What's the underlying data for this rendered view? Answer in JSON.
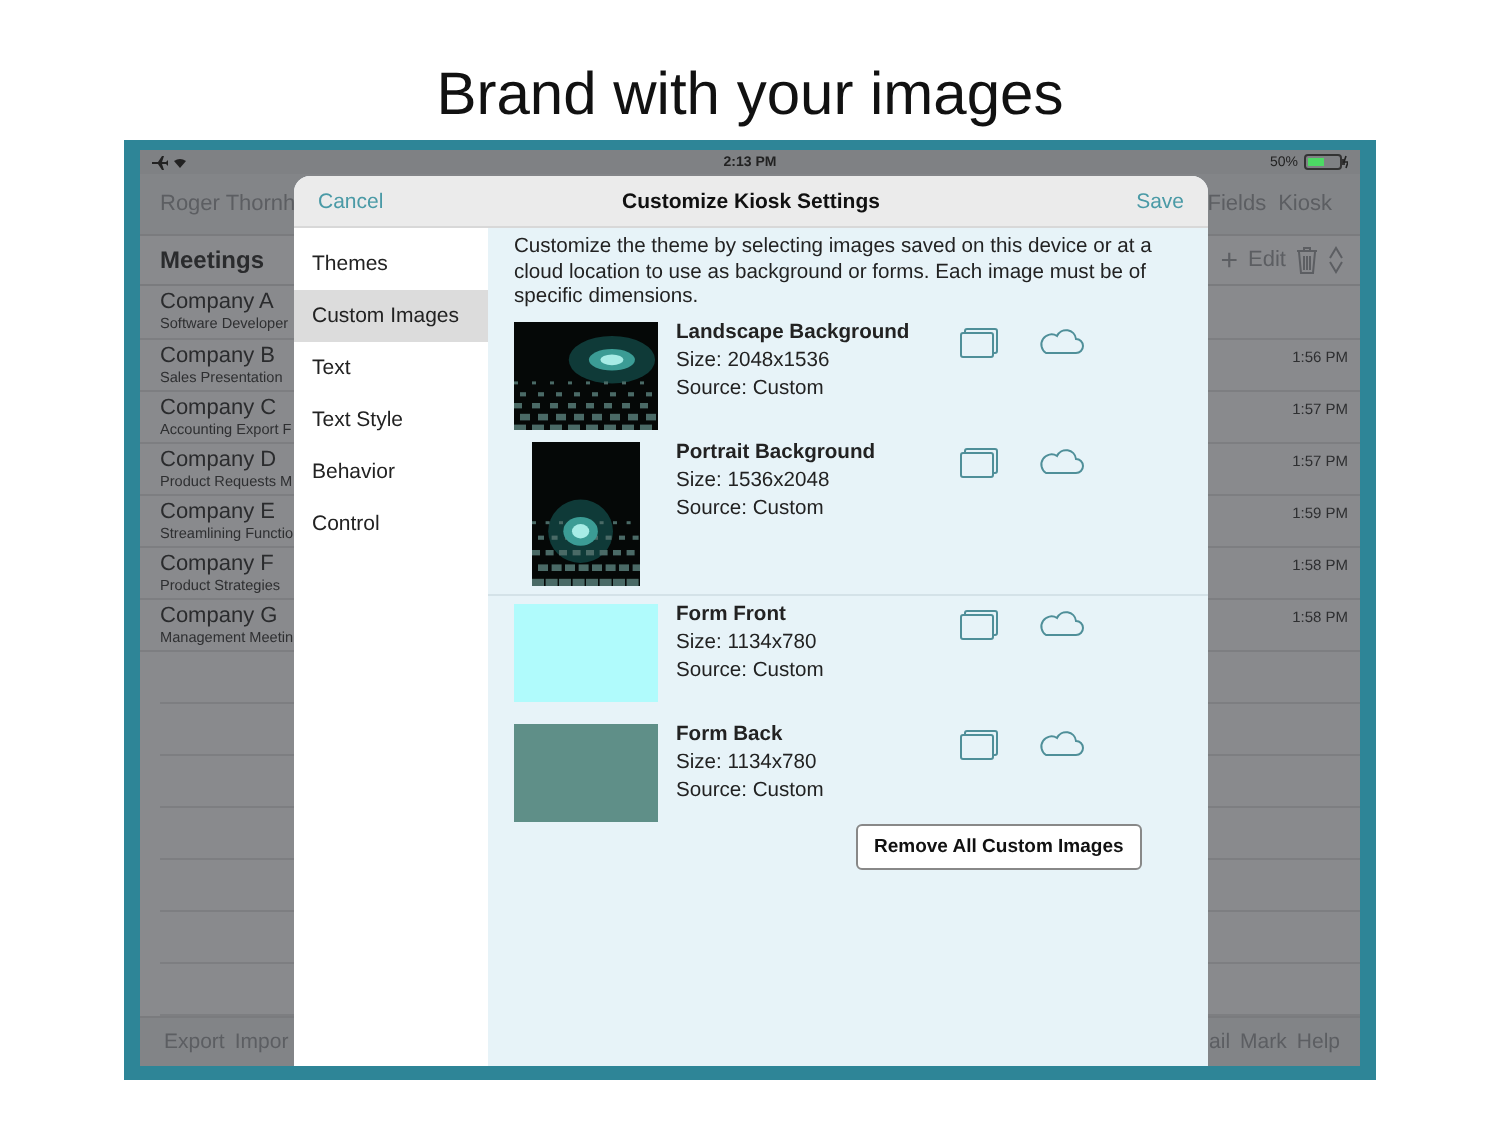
{
  "headline": "Brand with your images",
  "status_bar": {
    "time": "2:13 PM",
    "battery": "50%"
  },
  "app": {
    "user": "Roger Thornh",
    "header_actions": [
      "Fields",
      "Kiosk"
    ],
    "list_title": "Meetings",
    "add": "+",
    "edit": "Edit"
  },
  "meetings": [
    {
      "company": "Company A",
      "subtitle": "Software Developer"
    },
    {
      "company": "Company B",
      "subtitle": "Sales Presentation",
      "time": "1:56 PM"
    },
    {
      "company": "Company C",
      "subtitle": "Accounting Export F",
      "time": "1:57 PM"
    },
    {
      "company": "Company D",
      "subtitle": "Product Requests M",
      "time": "1:57 PM"
    },
    {
      "company": "Company E",
      "subtitle": "Streamlining Functio",
      "time": "1:59 PM"
    },
    {
      "company": "Company F",
      "subtitle": "Product Strategies",
      "time": "1:58 PM"
    },
    {
      "company": "Company G",
      "subtitle": "Management Meetin",
      "time": "1:58 PM"
    }
  ],
  "bottom_bar": {
    "left": [
      "Export",
      "Impor"
    ],
    "right": [
      "ail",
      "Mark",
      "Help"
    ]
  },
  "modal": {
    "cancel": "Cancel",
    "title": "Customize Kiosk Settings",
    "save": "Save",
    "menu": [
      {
        "label": "Themes",
        "selected": false
      },
      {
        "label": "Custom Images",
        "selected": true
      },
      {
        "label": "Text",
        "selected": false
      },
      {
        "label": "Text Style",
        "selected": false
      },
      {
        "label": "Behavior",
        "selected": false
      },
      {
        "label": "Control",
        "selected": false
      }
    ],
    "description": "Customize the theme by selecting images saved on this device or at a cloud location to use as background or forms.  Each image must be of specific dimensions.",
    "image_groups": [
      {
        "images": [
          {
            "kind": "landscape",
            "name": "Landscape Background",
            "size": "Size: 2048x1536",
            "source": "Source: Custom"
          },
          {
            "kind": "portrait",
            "name": "Portrait Background",
            "size": "Size: 1536x2048",
            "source": "Source: Custom"
          }
        ]
      },
      {
        "images": [
          {
            "kind": "swatch",
            "color": "#b0fbfc",
            "name": "Form Front",
            "size": "Size: 1134x780",
            "source": "Source: Custom"
          },
          {
            "kind": "swatch",
            "color": "#5f8f88",
            "name": "Form Back",
            "size": "Size: 1134x780",
            "source": "Source: Custom"
          }
        ]
      }
    ],
    "remove_button": "Remove All Custom Images"
  }
}
